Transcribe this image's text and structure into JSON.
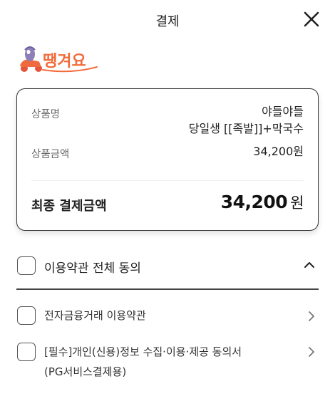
{
  "header": {
    "title": "결제",
    "close_icon": "close-icon"
  },
  "logo": {
    "text": "땡겨요",
    "icon": "delivery-scooter-icon",
    "color": "#f26b3a"
  },
  "summary": {
    "product_name_label": "상품명",
    "product_name_line1": "야들야들",
    "product_name_line2": "당일생 [[족발]]+막국수",
    "product_amount_label": "상품금액",
    "product_amount_value": "34,200원",
    "final_label": "최종 결제금액",
    "final_amount": "34,200",
    "final_unit": "원"
  },
  "agreement": {
    "all_label": "이용약관 전체 동의",
    "terms": [
      {
        "label": "전자금융거래 이용약관"
      },
      {
        "label_line1": "[필수]개인(신용)정보 수집·이용·제공 동의서",
        "label_line2": "(PG서비스결제용)"
      }
    ]
  },
  "colors": {
    "border": "#333333",
    "muted_text": "#6b6b6b",
    "brand": "#f26b3a"
  }
}
